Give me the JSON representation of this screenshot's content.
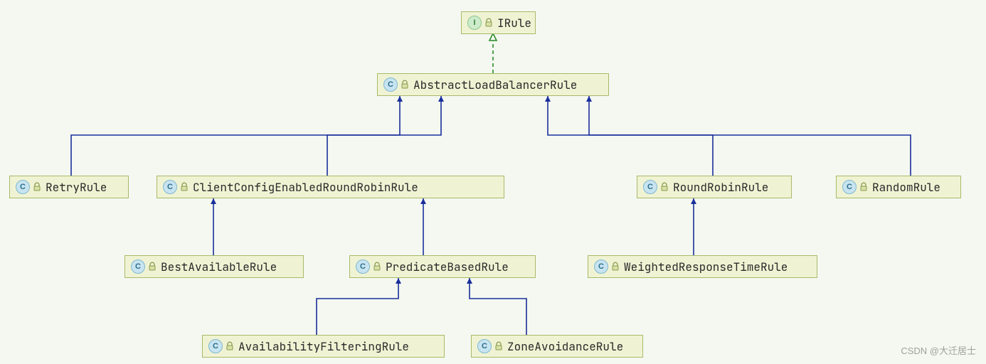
{
  "chart_data": {
    "type": "diagram",
    "title": "",
    "kind": "class-hierarchy",
    "nodes": [
      {
        "id": "IRule",
        "label": "IRule",
        "shape": "interface"
      },
      {
        "id": "AbstractLoadBalancerRule",
        "label": "AbstractLoadBalancerRule",
        "shape": "class"
      },
      {
        "id": "RetryRule",
        "label": "RetryRule",
        "shape": "class"
      },
      {
        "id": "ClientConfigEnabledRoundRobinRule",
        "label": "ClientConfigEnabledRoundRobinRule",
        "shape": "class"
      },
      {
        "id": "RoundRobinRule",
        "label": "RoundRobinRule",
        "shape": "class"
      },
      {
        "id": "RandomRule",
        "label": "RandomRule",
        "shape": "class"
      },
      {
        "id": "BestAvailableRule",
        "label": "BestAvailableRule",
        "shape": "class"
      },
      {
        "id": "PredicateBasedRule",
        "label": "PredicateBasedRule",
        "shape": "class"
      },
      {
        "id": "WeightedResponseTimeRule",
        "label": "WeightedResponseTimeRule",
        "shape": "class"
      },
      {
        "id": "AvailabilityFilteringRule",
        "label": "AvailabilityFilteringRule",
        "shape": "class"
      },
      {
        "id": "ZoneAvoidanceRule",
        "label": "ZoneAvoidanceRule",
        "shape": "class"
      }
    ],
    "edges": [
      {
        "from": "AbstractLoadBalancerRule",
        "to": "IRule",
        "relation": "implements"
      },
      {
        "from": "RetryRule",
        "to": "AbstractLoadBalancerRule",
        "relation": "extends"
      },
      {
        "from": "ClientConfigEnabledRoundRobinRule",
        "to": "AbstractLoadBalancerRule",
        "relation": "extends"
      },
      {
        "from": "RoundRobinRule",
        "to": "AbstractLoadBalancerRule",
        "relation": "extends"
      },
      {
        "from": "RandomRule",
        "to": "AbstractLoadBalancerRule",
        "relation": "extends"
      },
      {
        "from": "BestAvailableRule",
        "to": "ClientConfigEnabledRoundRobinRule",
        "relation": "extends"
      },
      {
        "from": "PredicateBasedRule",
        "to": "ClientConfigEnabledRoundRobinRule",
        "relation": "extends"
      },
      {
        "from": "WeightedResponseTimeRule",
        "to": "RoundRobinRule",
        "relation": "extends"
      },
      {
        "from": "AvailabilityFilteringRule",
        "to": "PredicateBasedRule",
        "relation": "extends"
      },
      {
        "from": "ZoneAvoidanceRule",
        "to": "PredicateBasedRule",
        "relation": "extends"
      }
    ]
  },
  "icons": {
    "class": "C",
    "interface": "I"
  },
  "watermark": "CSDN @大迁居士"
}
